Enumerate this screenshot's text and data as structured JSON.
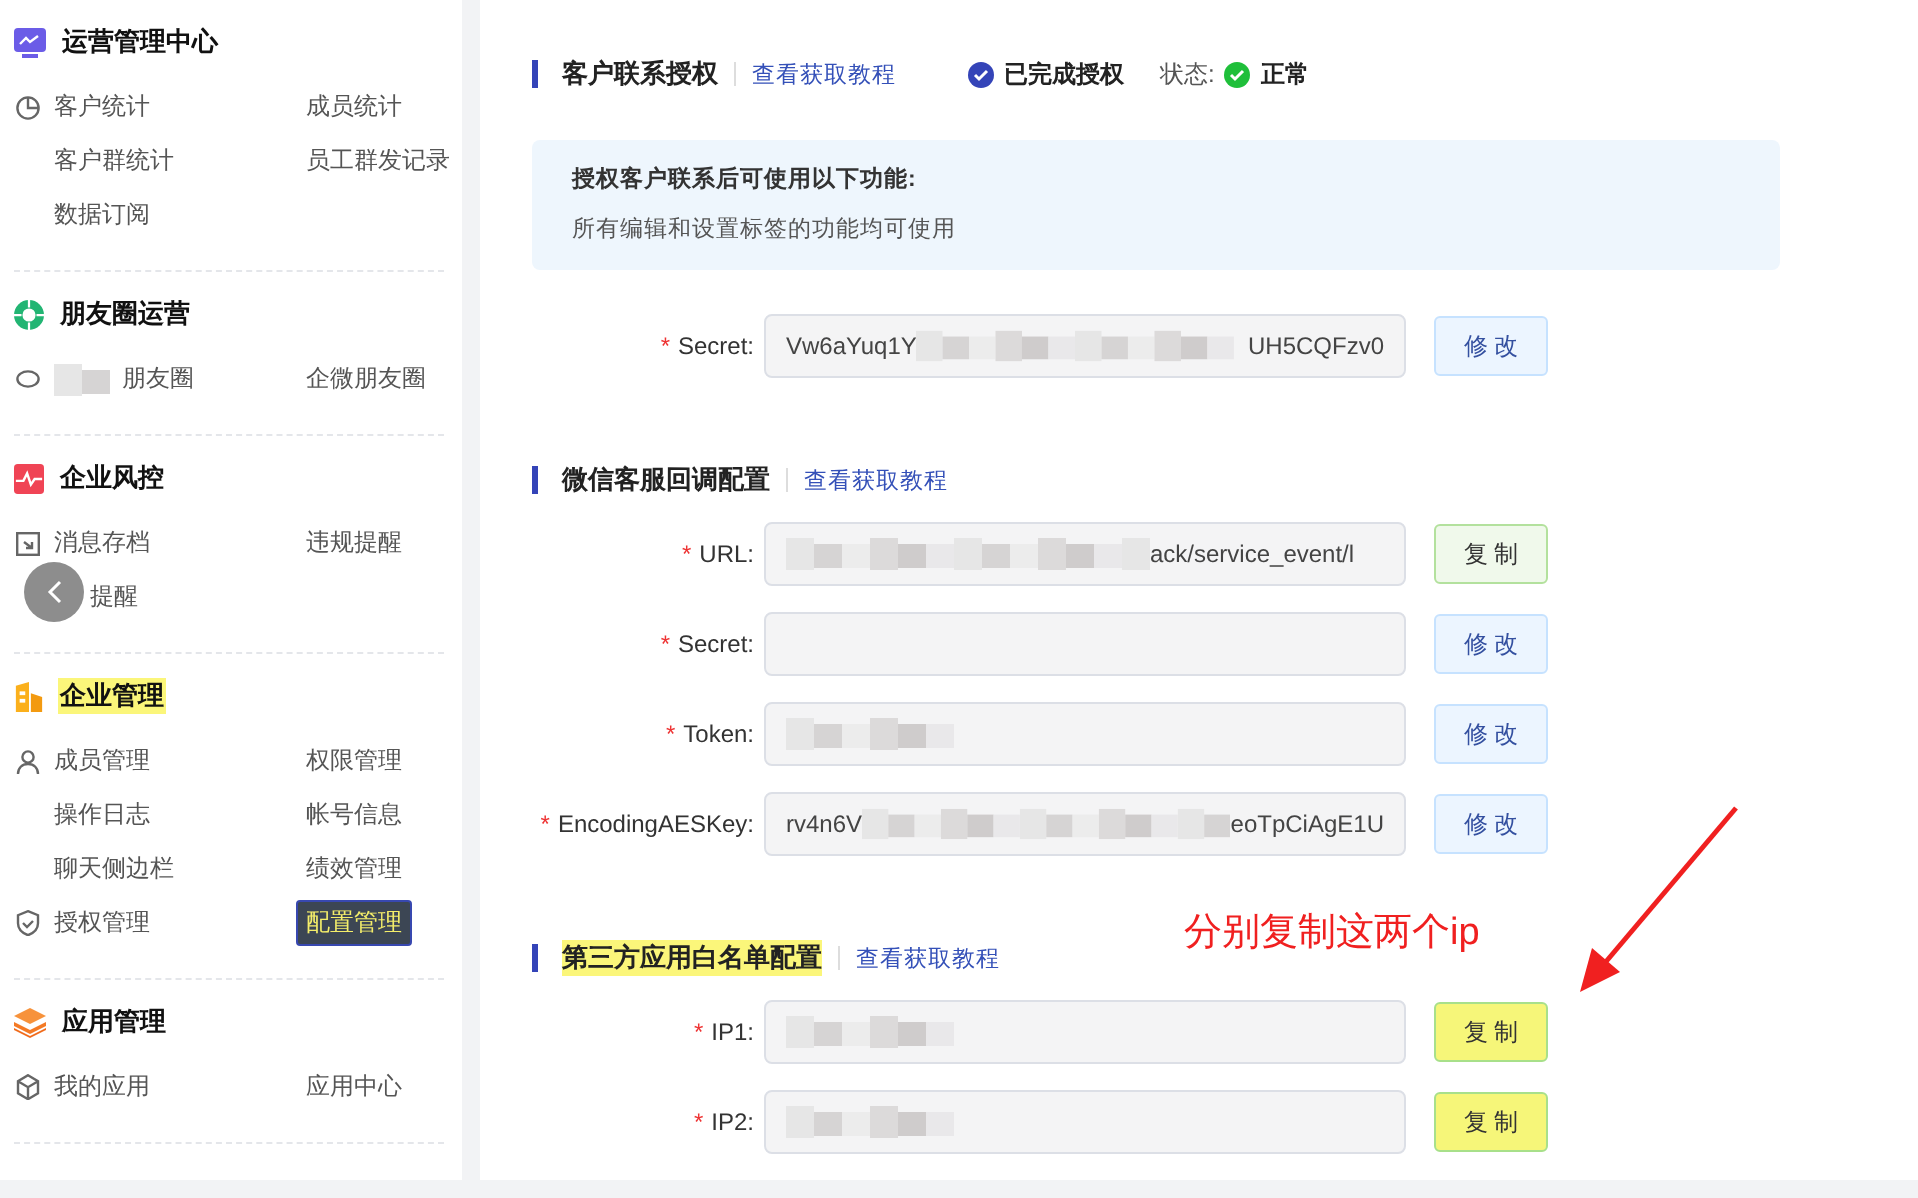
{
  "sidebar": {
    "sections": [
      {
        "title": "运营管理中心",
        "kind": "monitor",
        "highlighted": false,
        "items": [
          {
            "label": "客户统计",
            "kind": "pie",
            "selected": false
          },
          {
            "label": "成员统计",
            "selected": false
          },
          {
            "label": "客户群统计",
            "selected": false
          },
          {
            "label": "员工群发记录",
            "selected": false
          },
          {
            "label": "数据订阅",
            "selected": false
          }
        ]
      },
      {
        "title": "朋友圈运营",
        "kind": "aperture",
        "highlighted": false,
        "items": [
          {
            "label": "朋友圈",
            "kind": "chat",
            "redacted": true,
            "selected": false
          },
          {
            "label": "企微朋友圈",
            "selected": false
          }
        ]
      },
      {
        "title": "企业风控",
        "kind": "pulse",
        "highlighted": false,
        "items": [
          {
            "label": "消息存档",
            "kind": "archive",
            "selected": false
          },
          {
            "label": "违规提醒",
            "selected": false
          },
          {
            "label": "提醒",
            "covered": true,
            "selected": false
          }
        ]
      },
      {
        "title": "企业管理",
        "kind": "building",
        "highlighted": true,
        "items": [
          {
            "label": "成员管理",
            "kind": "person",
            "selected": false
          },
          {
            "label": "权限管理",
            "selected": false
          },
          {
            "label": "操作日志",
            "selected": false
          },
          {
            "label": "帐号信息",
            "selected": false
          },
          {
            "label": "聊天侧边栏",
            "selected": false
          },
          {
            "label": "绩效管理",
            "selected": false
          },
          {
            "label": "授权管理",
            "kind": "shield",
            "selected": false
          },
          {
            "label": "配置管理",
            "selected": true
          }
        ]
      },
      {
        "title": "应用管理",
        "kind": "layers",
        "highlighted": false,
        "items": [
          {
            "label": "我的应用",
            "kind": "cube",
            "selected": false
          },
          {
            "label": "应用中心",
            "selected": false
          }
        ]
      }
    ]
  },
  "main": {
    "sections": [
      {
        "title": "客户联系授权",
        "link": "查看获取教程",
        "highlighted": false,
        "status": {
          "authorized": "已完成授权",
          "state_label": "状态:",
          "state": "正常"
        },
        "notice": {
          "title": "授权客户联系后可使用以下功能:",
          "text": "所有编辑和设置标签的功能均可使用"
        },
        "fields": [
          {
            "marker": "*",
            "label": "Secret:",
            "prefix": "Vw6aYuq1Y",
            "suffix": "UH5CQFzv0",
            "redacted": true,
            "button": {
              "label": "修 改",
              "kind": "edit",
              "highlighted": false
            }
          }
        ]
      },
      {
        "title": "微信客服回调配置",
        "link": "查看获取教程",
        "highlighted": false,
        "fields": [
          {
            "marker": "*",
            "label": "URL:",
            "suffix": "ack/service_event/l",
            "redacted": true,
            "button": {
              "label": "复 制",
              "kind": "copy",
              "highlighted": false
            }
          },
          {
            "marker": "*",
            "label": "Secret:",
            "redacted": false,
            "button": {
              "label": "修 改",
              "kind": "edit",
              "highlighted": false
            }
          },
          {
            "marker": "*",
            "label": "Token:",
            "redacted": true,
            "button": {
              "label": "修 改",
              "kind": "edit",
              "highlighted": false
            }
          },
          {
            "marker": "*",
            "label": "EncodingAESKey:",
            "prefix": "rv4n6V",
            "suffix": "eoTpCiAgE1U",
            "redacted": true,
            "button": {
              "label": "修 改",
              "kind": "edit",
              "highlighted": false
            }
          }
        ]
      },
      {
        "title": "第三方应用白名单配置",
        "link": "查看获取教程",
        "highlighted": true,
        "fields": [
          {
            "marker": "*",
            "label": "IP1:",
            "redacted": true,
            "button": {
              "label": "复 制",
              "kind": "copy",
              "highlighted": true
            }
          },
          {
            "marker": "*",
            "label": "IP2:",
            "redacted": true,
            "button": {
              "label": "复 制",
              "kind": "copy",
              "highlighted": true
            }
          }
        ]
      }
    ]
  },
  "annotation": {
    "text": "分别复制这两个ip"
  }
}
